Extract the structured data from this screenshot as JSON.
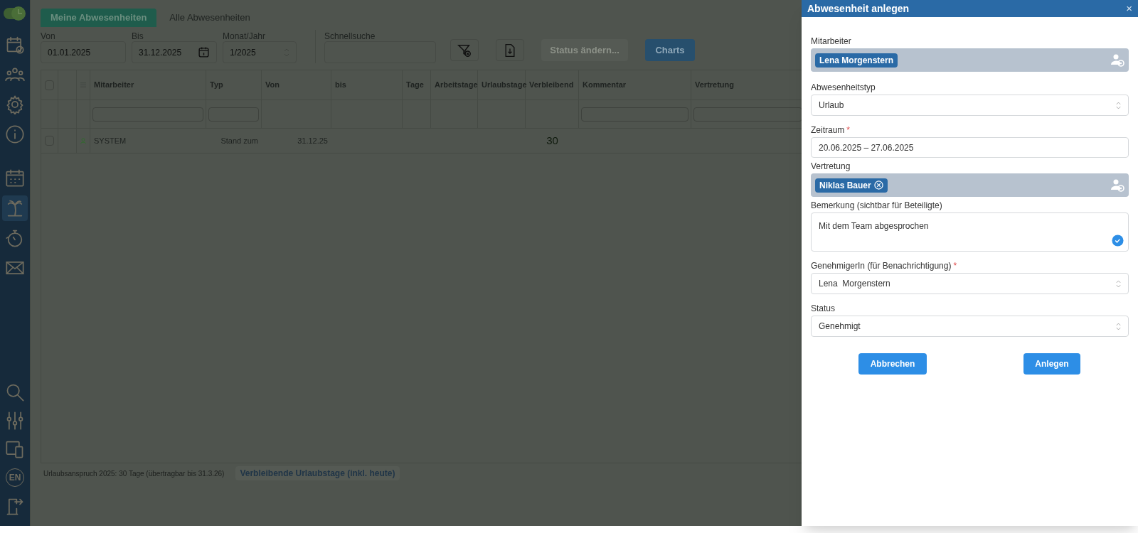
{
  "sidebar": {
    "items": [
      {
        "selected": false
      },
      {
        "selected": false
      },
      {
        "selected": false
      },
      {
        "selected": false
      },
      {
        "selected": false
      },
      {
        "selected": true
      },
      {
        "selected": false
      },
      {
        "selected": false
      }
    ],
    "bottom_items": [
      {
        "selected": false
      },
      {
        "selected": false
      },
      {
        "selected": false
      },
      {
        "label": "EN",
        "selected": false
      },
      {
        "selected": false
      }
    ]
  },
  "tabs": [
    {
      "label": "Meine Abwesenheiten",
      "selected": true
    },
    {
      "label": "Alle Abwesenheiten",
      "selected": false
    }
  ],
  "filters": [
    {
      "kind": "date",
      "label": "Von",
      "value": "01.01.2025"
    },
    {
      "kind": "date-picker",
      "label": "Bis",
      "value": "31.12.2025"
    },
    {
      "kind": "select",
      "label": "Monat/Jahr",
      "value": "1/2025"
    },
    {
      "kind": "search",
      "label": "Schnellsuche"
    }
  ],
  "toolbar": {
    "buttons": [
      {
        "kind": "filter-clear"
      },
      {
        "kind": "export"
      },
      {
        "kind": "text",
        "label": "Status ändern...",
        "disabled": true
      },
      {
        "kind": "text",
        "label": "Charts",
        "disabled": false
      }
    ]
  },
  "table": {
    "columns": [
      {
        "kind": "checkbox",
        "checked": false
      },
      {
        "kind": "blank"
      },
      {
        "kind": "menu"
      },
      {
        "kind": "text",
        "label": "Mitarbeiter",
        "filter": true
      },
      {
        "kind": "text",
        "label": "Typ",
        "filter": true
      },
      {
        "kind": "text",
        "label": "Von",
        "filter": false
      },
      {
        "kind": "text",
        "label": "bis",
        "filter": false
      },
      {
        "kind": "text",
        "label": "Tage",
        "filter": false
      },
      {
        "kind": "text",
        "label": "Arbeitstage",
        "filter": false
      },
      {
        "kind": "text",
        "label": "Urlaubstage",
        "filter": false
      },
      {
        "kind": "number",
        "label": "Verbleibend",
        "filter": false
      },
      {
        "kind": "text",
        "label": "Kommentar",
        "filter": true
      },
      {
        "kind": "text",
        "label": "Vertretung",
        "filter": true
      }
    ],
    "rows": [
      {
        "checked": false,
        "cells": [
          "",
          "",
          "",
          "SYSTEM",
          "Stand zum",
          "31.12.25",
          "",
          "",
          "",
          "",
          "30",
          "",
          ""
        ]
      }
    ]
  },
  "footer": {
    "note": "Urlaubsanspruch 2025: 30 Tage (übertragbar bis 31.3.26)",
    "button": "Verbleibende Urlaubstage (inkl. heute)"
  },
  "dialog": {
    "title": "Abwesenheit anlegen",
    "close": "×",
    "fields": [
      {
        "kind": "tags",
        "label": "Mitarbeiter",
        "tags": [
          {
            "label": "Lena Morgenstern",
            "removable": false
          }
        ]
      },
      {
        "kind": "select",
        "label": "Abwesenheitstyp",
        "value": "Urlaub"
      },
      {
        "kind": "text",
        "label": "Zeitraum",
        "required_mark": "*",
        "value": "20.06.2025 – 27.06.2025"
      },
      {
        "kind": "tags",
        "label": "Vertretung",
        "tags": [
          {
            "label": "Niklas Bauer",
            "removable": true
          }
        ]
      },
      {
        "kind": "textarea",
        "label": "Bemerkung (sichtbar für Beteiligte)",
        "value": "Mit dem Team abgesprochen"
      },
      {
        "kind": "select",
        "label": "GenehmigerIn (für Benachrichtigung)",
        "required_mark": "*",
        "value": "Lena  Morgenstern"
      },
      {
        "kind": "select",
        "label": "Status",
        "value": "Genehmigt"
      }
    ],
    "buttons": [
      "Abbrechen",
      "Anlegen"
    ]
  }
}
